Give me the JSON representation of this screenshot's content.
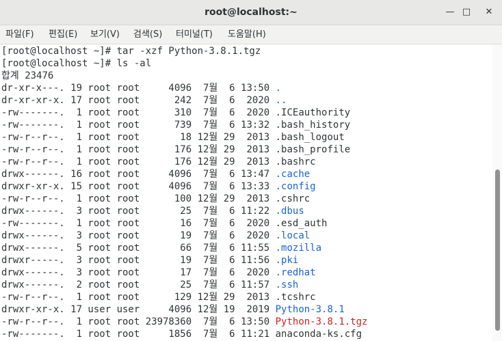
{
  "window": {
    "title": "root@localhost:~",
    "minimize_glyph": "—",
    "maximize_glyph": "□",
    "close_glyph": "✕"
  },
  "menu": {
    "items": [
      "파일(F)",
      "편집(E)",
      "보기(V)",
      "검색(S)",
      "터미널(T)",
      "도움말(H)"
    ]
  },
  "colors": {
    "text": "#2e3436",
    "dir": "#1a62d4",
    "archive": "#cc2222"
  },
  "terminal": {
    "lines": [
      {
        "segments": [
          {
            "text": "[root@localhost ~]# tar -xzf Python-3.8.1.tgz",
            "color": "text"
          }
        ]
      },
      {
        "segments": [
          {
            "text": "[root@localhost ~]# ls -al",
            "color": "text"
          }
        ]
      },
      {
        "segments": [
          {
            "text": "합계 23476",
            "color": "text"
          }
        ]
      },
      {
        "segments": [
          {
            "text": "dr-xr-x---. 19 root root     4096  7월  6 13:50 ",
            "color": "text"
          },
          {
            "text": ".",
            "color": "dir"
          }
        ]
      },
      {
        "segments": [
          {
            "text": "dr-xr-xr-x. 17 root root      242  7월  6  2020 ",
            "color": "text"
          },
          {
            "text": "..",
            "color": "dir"
          }
        ]
      },
      {
        "segments": [
          {
            "text": "-rw-------.  1 root root      310  7월  6  2020 .ICEauthority",
            "color": "text"
          }
        ]
      },
      {
        "segments": [
          {
            "text": "-rw-------.  1 root root      739  7월  6 13:32 .bash_history",
            "color": "text"
          }
        ]
      },
      {
        "segments": [
          {
            "text": "-rw-r--r--.  1 root root       18 12월 29  2013 .bash_logout",
            "color": "text"
          }
        ]
      },
      {
        "segments": [
          {
            "text": "-rw-r--r--.  1 root root      176 12월 29  2013 .bash_profile",
            "color": "text"
          }
        ]
      },
      {
        "segments": [
          {
            "text": "-rw-r--r--.  1 root root      176 12월 29  2013 .bashrc",
            "color": "text"
          }
        ]
      },
      {
        "segments": [
          {
            "text": "drwx------. 16 root root     4096  7월  6 13:47 ",
            "color": "text"
          },
          {
            "text": ".cache",
            "color": "dir"
          }
        ]
      },
      {
        "segments": [
          {
            "text": "drwxr-xr-x. 15 root root     4096  7월  6 13:33 ",
            "color": "text"
          },
          {
            "text": ".config",
            "color": "dir"
          }
        ]
      },
      {
        "segments": [
          {
            "text": "-rw-r--r--.  1 root root      100 12월 29  2013 .cshrc",
            "color": "text"
          }
        ]
      },
      {
        "segments": [
          {
            "text": "drwx------.  3 root root       25  7월  6 11:22 ",
            "color": "text"
          },
          {
            "text": ".dbus",
            "color": "dir"
          }
        ]
      },
      {
        "segments": [
          {
            "text": "-rw-------.  1 root root       16  7월  6  2020 .esd_auth",
            "color": "text"
          }
        ]
      },
      {
        "segments": [
          {
            "text": "drwx------.  3 root root       19  7월  6  2020 ",
            "color": "text"
          },
          {
            "text": ".local",
            "color": "dir"
          }
        ]
      },
      {
        "segments": [
          {
            "text": "drwx------.  5 root root       66  7월  6 11:55 ",
            "color": "text"
          },
          {
            "text": ".mozilla",
            "color": "dir"
          }
        ]
      },
      {
        "segments": [
          {
            "text": "drwxr-----.  3 root root       19  7월  6 11:56 ",
            "color": "text"
          },
          {
            "text": ".pki",
            "color": "dir"
          }
        ]
      },
      {
        "segments": [
          {
            "text": "drwx------.  3 root root       17  7월  6  2020 ",
            "color": "text"
          },
          {
            "text": ".redhat",
            "color": "dir"
          }
        ]
      },
      {
        "segments": [
          {
            "text": "drwx------.  2 root root       25  7월  6 11:57 ",
            "color": "text"
          },
          {
            "text": ".ssh",
            "color": "dir"
          }
        ]
      },
      {
        "segments": [
          {
            "text": "-rw-r--r--.  1 root root      129 12월 29  2013 .tcshrc",
            "color": "text"
          }
        ]
      },
      {
        "segments": [
          {
            "text": "drwxr-xr-x. 17 user user     4096 12월 19  2019 ",
            "color": "text"
          },
          {
            "text": "Python-3.8.1",
            "color": "dir"
          }
        ]
      },
      {
        "segments": [
          {
            "text": "-rw-r--r--.  1 root root 23978360  7월  6 13:50 ",
            "color": "text"
          },
          {
            "text": "Python-3.8.1.tgz",
            "color": "archive"
          }
        ]
      },
      {
        "segments": [
          {
            "text": "-rw-------.  1 root root     1856  7월  6 11:21 anaconda-ks.cfg",
            "color": "text"
          }
        ]
      }
    ]
  }
}
